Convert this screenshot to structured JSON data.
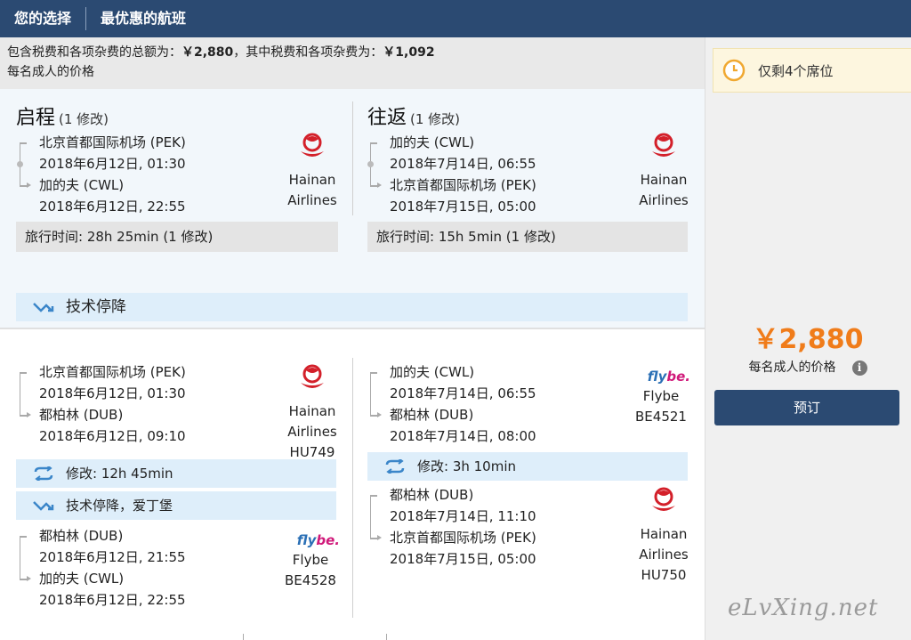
{
  "header": {
    "tab_selection": "您的选择",
    "tab_best": "最优惠的航班"
  },
  "summary": {
    "line1_prefix": "包含税费和各项杂费的总额为：",
    "total": "￥2,880",
    "line1_mid": "，其中税费和各项杂费为：",
    "taxes": "￥1,092",
    "line2": "每名成人的价格"
  },
  "outbound": {
    "title": "启程",
    "changes": "(1 修改)",
    "from": "北京首都国际机场 (PEK)",
    "depart": "2018年6月12日, 01:30",
    "to": "加的夫 (CWL)",
    "arrive": "2018年6月12日, 22:55",
    "airline": [
      "Hainan",
      "Airlines"
    ],
    "travel_time": "旅行时间:  28h 25min (1 修改)"
  },
  "inbound": {
    "title": "往返",
    "changes": "(1 修改)",
    "from": "加的夫 (CWL)",
    "depart": "2018年7月14日, 06:55",
    "to": "北京首都国际机场 (PEK)",
    "arrive": "2018年7月15日, 05:00",
    "airline": [
      "Hainan",
      "Airlines"
    ],
    "travel_time": "旅行时间:  15h 5min (1 修改)"
  },
  "tech_stop_banner": "技术停降",
  "detail_out": {
    "seg1": {
      "from": "北京首都国际机场 (PEK)",
      "depart": "2018年6月12日, 01:30",
      "to": "都柏林 (DUB)",
      "arrive": "2018年6月12日, 09:10",
      "airline": [
        "Hainan",
        "Airlines",
        "HU749"
      ]
    },
    "change": "修改: 12h 45min",
    "tech_stop": "技术停降，爱丁堡",
    "seg2": {
      "from": "都柏林 (DUB)",
      "depart": "2018年6月12日, 21:55",
      "to": "加的夫 (CWL)",
      "arrive": "2018年6月12日, 22:55",
      "airline": [
        "Flybe",
        "BE4528"
      ]
    }
  },
  "detail_in": {
    "seg1": {
      "from": "加的夫 (CWL)",
      "depart": "2018年7月14日, 06:55",
      "to": "都柏林 (DUB)",
      "arrive": "2018年7月14日, 08:00",
      "airline": [
        "Flybe",
        "BE4521"
      ]
    },
    "change": "修改: 3h 10min",
    "seg2": {
      "from": "都柏林 (DUB)",
      "depart": "2018年7月14日, 11:10",
      "to": "北京首都国际机场 (PEK)",
      "arrive": "2018年7月15日, 05:00",
      "airline": [
        "Hainan",
        "Airlines",
        "HU750"
      ]
    }
  },
  "flybe_logo": {
    "fly": "fly",
    "be": "be."
  },
  "sidebar": {
    "seats_left": "仅剩4个席位",
    "price": "￥2,880",
    "price_note": "每名成人的价格",
    "info": "i",
    "book_label": "预订"
  },
  "watermark": "eLvXing.net",
  "colors": {
    "header": "#2b4a72",
    "price": "#f07c1a",
    "info_bar": "#deeefa",
    "hainan_red": "#d3202a",
    "flybe_blue": "#2a6fb5",
    "flybe_pink": "#d0197a"
  }
}
